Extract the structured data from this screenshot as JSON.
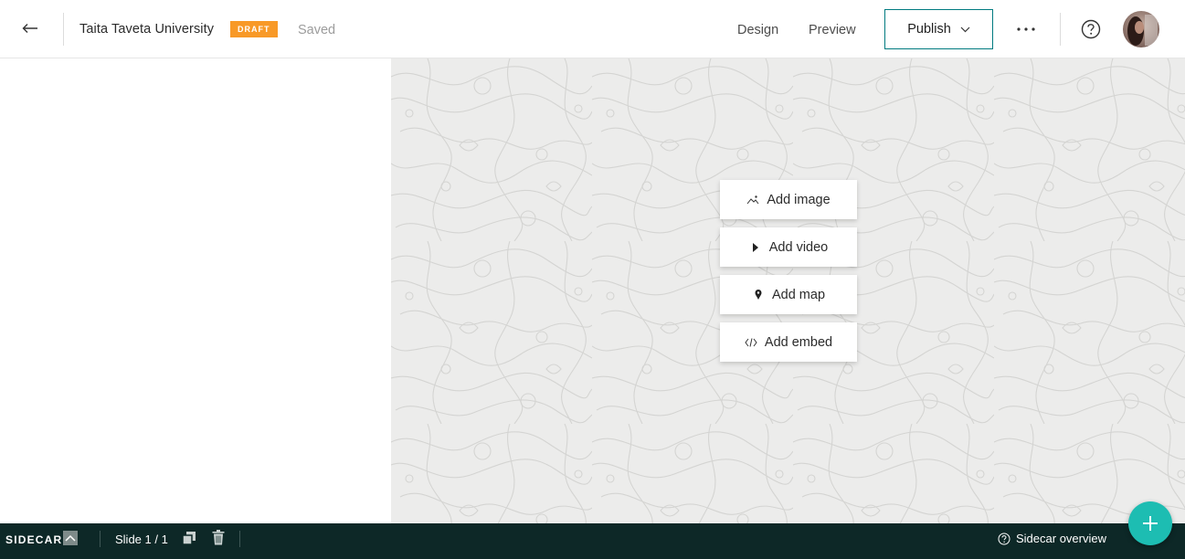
{
  "header": {
    "back_icon": "arrow-left-icon",
    "title": "Taita Taveta University",
    "badge": "DRAFT",
    "status": "Saved",
    "nav": {
      "design": "Design",
      "preview": "Preview"
    },
    "publish_label": "Publish",
    "more_icon": "more-horizontal-icon",
    "help_icon": "question-circle-icon"
  },
  "stage": {
    "buttons": [
      {
        "label": "Add image",
        "icon": "image-icon"
      },
      {
        "label": "Add video",
        "icon": "play-icon"
      },
      {
        "label": "Add map",
        "icon": "map-pin-icon"
      },
      {
        "label": "Add embed",
        "icon": "code-icon"
      }
    ]
  },
  "footer": {
    "sidecar_label": "SIDECAR",
    "slide_label": "Slide 1 / 1",
    "overview_label": "Sidecar overview"
  },
  "colors": {
    "accent": "#007a80",
    "badge": "#f89927",
    "footer_bg": "#0d2827",
    "fab": "#1dbdb2",
    "stage_bg": "#ececeb"
  }
}
